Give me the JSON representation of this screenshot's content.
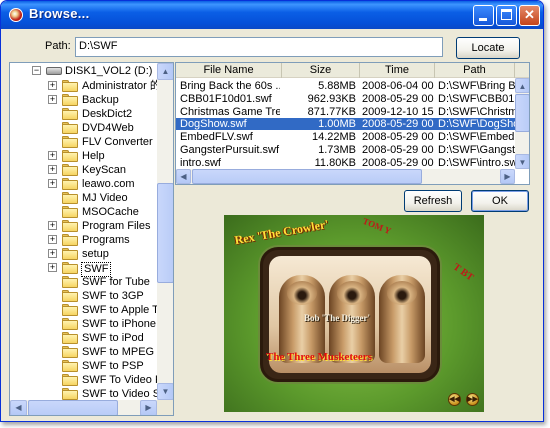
{
  "window": {
    "title": "Browse...",
    "minimize_glyph": "",
    "close_glyph": "✕"
  },
  "path_bar": {
    "label": "Path:",
    "value": "D:\\SWF",
    "locate_label": "Locate"
  },
  "tree": {
    "root_label": "DISK1_VOL2 (D:)",
    "items": [
      {
        "label": "Administrator 的文",
        "expander": "+"
      },
      {
        "label": "Backup",
        "expander": "+"
      },
      {
        "label": "DeskDict2",
        "expander": ""
      },
      {
        "label": "DVD4Web",
        "expander": ""
      },
      {
        "label": "FLV Converter",
        "expander": ""
      },
      {
        "label": "Help",
        "expander": "+"
      },
      {
        "label": "KeyScan",
        "expander": "+"
      },
      {
        "label": "leawo.com",
        "expander": "+"
      },
      {
        "label": "MJ Video",
        "expander": ""
      },
      {
        "label": "MSOCache",
        "expander": ""
      },
      {
        "label": "Program Files",
        "expander": "+"
      },
      {
        "label": "Programs",
        "expander": "+"
      },
      {
        "label": "setup",
        "expander": "+"
      },
      {
        "label": "SWF",
        "expander": "+"
      },
      {
        "label": "SWF for Tube",
        "expander": ""
      },
      {
        "label": "SWF to 3GP",
        "expander": ""
      },
      {
        "label": "SWF to Apple TV",
        "expander": ""
      },
      {
        "label": "SWF to iPhone",
        "expander": ""
      },
      {
        "label": "SWF to iPod",
        "expander": ""
      },
      {
        "label": "SWF to MPEG",
        "expander": ""
      },
      {
        "label": "SWF to PSP",
        "expander": ""
      },
      {
        "label": "SWF To Video Pr",
        "expander": ""
      },
      {
        "label": "SWF to Video Std",
        "expander": ""
      }
    ],
    "selected_index": 13
  },
  "file_list": {
    "columns": [
      "File Name",
      "Size",
      "Time",
      "Path"
    ],
    "rows": [
      [
        "Bring Back the 60s ...",
        "5.88MB",
        "2008-06-04 00:0...",
        "D:\\SWF\\Bring Ba"
      ],
      [
        "CBB01F10d01.swf",
        "962.93KB",
        "2008-05-29 00:0...",
        "D:\\SWF\\CBB01F1"
      ],
      [
        "Christmas Game Tre...",
        "871.77KB",
        "2009-12-10 15:0...",
        "D:\\SWF\\Christmas"
      ],
      [
        "DogShow.swf",
        "1.00MB",
        "2008-05-29 00:0...",
        "D:\\SWF\\DogSho."
      ],
      [
        "EmbedFLV.swf",
        "14.22MB",
        "2008-05-29 00:0...",
        "D:\\SWF\\EmbedFL"
      ],
      [
        "GangsterPursuit.swf",
        "1.73MB",
        "2008-05-29 00:0...",
        "D:\\SWF\\Gangster"
      ],
      [
        "intro.swf",
        "11.80KB",
        "2008-05-29 00:0...",
        "D:\\SWF\\intro.sw"
      ]
    ],
    "selected_index": 3
  },
  "buttons": {
    "refresh_label": "Refresh",
    "ok_label": "OK"
  },
  "preview": {
    "text_rex": "Rex 'The Crowler'",
    "text_tom": "TOM Y",
    "text_bet": "T BT",
    "text_bob": "Bob 'The Digger'",
    "text_three": "The Three Musketeers",
    "prev_glyph": "◀◀",
    "next_glyph": "▶▶"
  },
  "scroll_glyphs": {
    "up": "▲",
    "down": "▼",
    "left": "◀",
    "right": "▶"
  }
}
